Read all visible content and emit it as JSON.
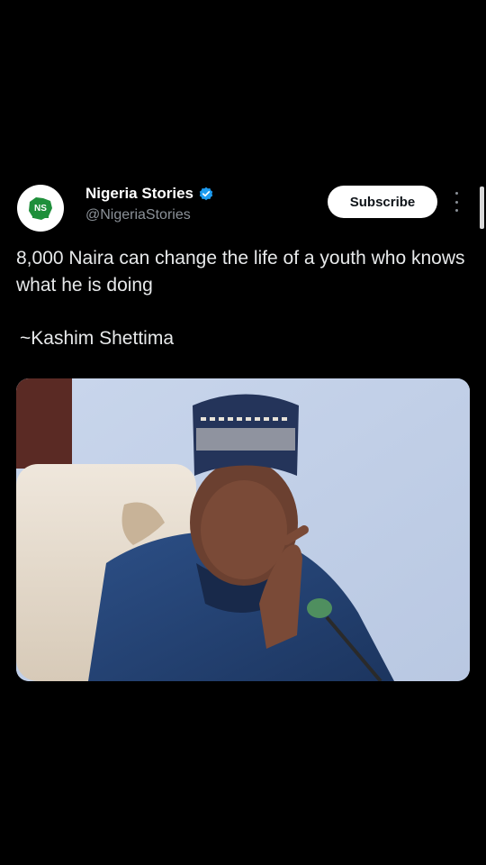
{
  "post": {
    "author_name": "Nigeria Stories",
    "author_handle": "@NigeriaStories",
    "subscribe_label": "Subscribe",
    "body": "8,000 Naira can change the life of a youth who knows what he is doing",
    "quote": "~Kashim Shettima",
    "avatar_text": "NS"
  },
  "colors": {
    "background": "#000000",
    "verified_blue": "#1d9bf0",
    "text_primary": "#e7e9ea",
    "text_secondary": "#8b9198"
  },
  "icons": {
    "verified": "verified-badge-icon",
    "more": "more-options-icon"
  }
}
